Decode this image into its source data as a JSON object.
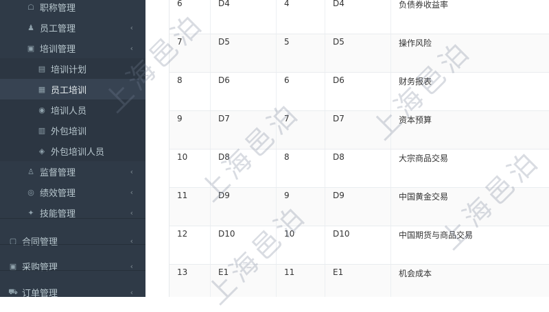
{
  "sidebar": {
    "items": [
      {
        "label": "职称管理",
        "icon": "user-tag-icon",
        "level": "sub",
        "chevron": ""
      },
      {
        "label": "员工管理",
        "icon": "user-icon",
        "level": "sub",
        "chevron": "‹"
      },
      {
        "label": "培训管理",
        "icon": "briefcase-icon",
        "level": "sub",
        "chevron": "‹"
      },
      {
        "label": "培训计划",
        "icon": "plan-icon",
        "level": "subsub",
        "chevron": ""
      },
      {
        "label": "员工培训",
        "icon": "training-icon",
        "level": "subsub",
        "chevron": ""
      },
      {
        "label": "培训人员",
        "icon": "eye-icon",
        "level": "subsub",
        "chevron": ""
      },
      {
        "label": "外包培训",
        "icon": "outsource-icon",
        "level": "subsub",
        "chevron": ""
      },
      {
        "label": "外包培训人员",
        "icon": "outsource-user-icon",
        "level": "subsub",
        "chevron": ""
      },
      {
        "label": "监督管理",
        "icon": "supervise-icon",
        "level": "sub",
        "chevron": "‹"
      },
      {
        "label": "绩效管理",
        "icon": "performance-icon",
        "level": "sub",
        "chevron": "‹"
      },
      {
        "label": "技能管理",
        "icon": "skill-icon",
        "level": "sub",
        "chevron": "‹"
      },
      {
        "label": "合同管理",
        "icon": "contract-icon",
        "level": "top",
        "chevron": "‹"
      },
      {
        "label": "采购管理",
        "icon": "purchase-icon",
        "level": "top",
        "chevron": "‹"
      },
      {
        "label": "订单管理",
        "icon": "cart-icon",
        "level": "top",
        "chevron": "‹"
      }
    ],
    "active_index": 4
  },
  "table": {
    "rows": [
      [
        "6",
        "D4",
        "4",
        "D4",
        "负债券收益率"
      ],
      [
        "7",
        "D5",
        "5",
        "D5",
        "操作风险"
      ],
      [
        "8",
        "D6",
        "6",
        "D6",
        "财务报表"
      ],
      [
        "9",
        "D7",
        "7",
        "D7",
        "资本预算"
      ],
      [
        "10",
        "D8",
        "8",
        "D8",
        "大宗商品交易"
      ],
      [
        "11",
        "D9",
        "9",
        "D9",
        "中国黄金交易"
      ],
      [
        "12",
        "D10",
        "10",
        "D10",
        "中国期货与商品交易"
      ],
      [
        "13",
        "E1",
        "11",
        "E1",
        "机会成本"
      ]
    ]
  },
  "watermark": "上海邑泊",
  "colors": {
    "sidebar_bg": "#2f3a47",
    "sidebar_active": "#374352",
    "sidebar_text": "#b8c7ce"
  }
}
